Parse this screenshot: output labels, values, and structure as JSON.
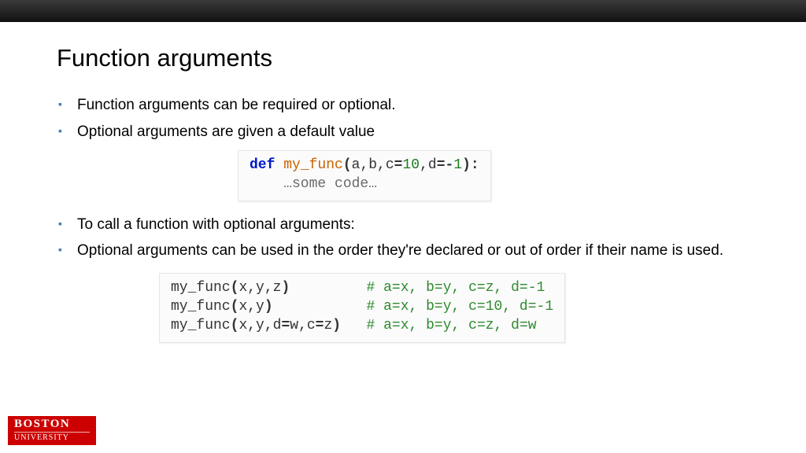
{
  "title": "Function arguments",
  "bullets_a": [
    "Function arguments can be required or optional.",
    "Optional arguments are given a default value"
  ],
  "bullets_b": [
    "To call a function with optional arguments:",
    "Optional arguments can be used in the order they're declared or out of order if their name is used."
  ],
  "code1": {
    "kw": "def",
    "fn": "my_func",
    "open": "(",
    "args_plain": "a,b,c",
    "eq1": "=",
    "num1": "10",
    "comma": ",d",
    "eq2": "=-",
    "num2": "1",
    "close": "):",
    "body": "    …some code…"
  },
  "code2": {
    "l1a": "my_func",
    "l1b": "(",
    "l1c": "x,y,z",
    "l1d": ")",
    "l1pad": "         ",
    "l1cm": "# a=x, b=y, c=z, d=-1",
    "l2a": "my_func",
    "l2b": "(",
    "l2c": "x,y",
    "l2d": ")",
    "l2pad": "           ",
    "l2cm": "# a=x, b=y, c=10, d=-1",
    "l3a": "my_func",
    "l3b": "(",
    "l3c1": "x,y,d",
    "l3eq1": "=",
    "l3c2": "w,c",
    "l3eq2": "=",
    "l3c3": "z",
    "l3d": ")",
    "l3pad": "   ",
    "l3cm": "# a=x, b=y, c=z, d=w"
  },
  "logo": {
    "line1": "BOSTON",
    "line2": "UNIVERSITY"
  }
}
